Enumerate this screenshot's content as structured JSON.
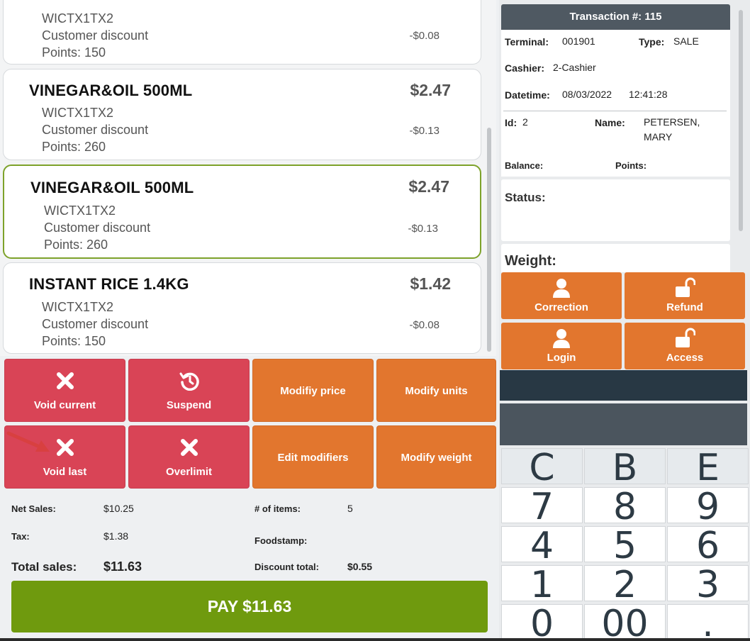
{
  "receipt": {
    "items": [
      {
        "name": "",
        "price": "",
        "sub": [
          "WICTX1TX2",
          "Customer discount",
          "Points: 150"
        ],
        "discount": "-$0.08"
      },
      {
        "name": "VINEGAR&OIL 500ML",
        "price": "$2.47",
        "sub": [
          "WICTX1TX2",
          "Customer discount",
          "Points: 260"
        ],
        "discount": "-$0.13"
      },
      {
        "name": "VINEGAR&OIL 500ML",
        "price": "$2.47",
        "sub": [
          "WICTX1TX2",
          "Customer discount",
          "Points: 260"
        ],
        "discount": "-$0.13"
      },
      {
        "name": "INSTANT RICE 1.4KG",
        "price": "$1.42",
        "sub": [
          "WICTX1TX2",
          "Customer discount",
          "Points: 150"
        ],
        "discount": "-$0.08"
      }
    ]
  },
  "actions": {
    "void_current": "Void current",
    "suspend": "Suspend",
    "modify_price": "Modifiy price",
    "modify_units": "Modify units",
    "void_last": "Void last",
    "overlimit": "Overlimit",
    "edit_modifiers": "Edit modifiers",
    "modify_weight": "Modify weight"
  },
  "totals": {
    "net_sales_label": "Net Sales:",
    "net_sales": "$10.25",
    "tax_label": "Tax:",
    "tax": "$1.38",
    "total_label": "Total sales:",
    "total": "$11.63",
    "items_label": "# of items:",
    "items": "5",
    "foodstamp_label": "Foodstamp:",
    "discount_label": "Discount total:",
    "discount": "$0.55"
  },
  "pay_label": "PAY $11.63",
  "transaction": {
    "header": "Transaction #: 115",
    "terminal_label": "Terminal:",
    "terminal": "001901",
    "type_label": "Type:",
    "type": "SALE",
    "cashier_label": "Cashier:",
    "cashier": "2-Cashier",
    "datetime_label": "Datetime:",
    "date": "08/03/2022",
    "time": "12:41:28",
    "id_label": "Id:",
    "id": "2",
    "name_label": "Name:",
    "name_line1": "PETERSEN,",
    "name_line2": "MARY",
    "balance_label": "Balance:",
    "points_label": "Points:"
  },
  "status_label": "Status:",
  "weight_label": "Weight:",
  "right_buttons": {
    "correction": "Correction",
    "refund": "Refund",
    "login": "Login",
    "access": "Access"
  },
  "keypad": [
    "C",
    "B",
    "E",
    "7",
    "8",
    "9",
    "4",
    "5",
    "6",
    "1",
    "2",
    "3",
    "0",
    "00",
    "."
  ],
  "colors": {
    "red": "#d94456",
    "orange": "#e2762e",
    "pay_green": "#6f9a0e",
    "header_gray": "#4f5962",
    "selected_border": "#7da22a"
  }
}
